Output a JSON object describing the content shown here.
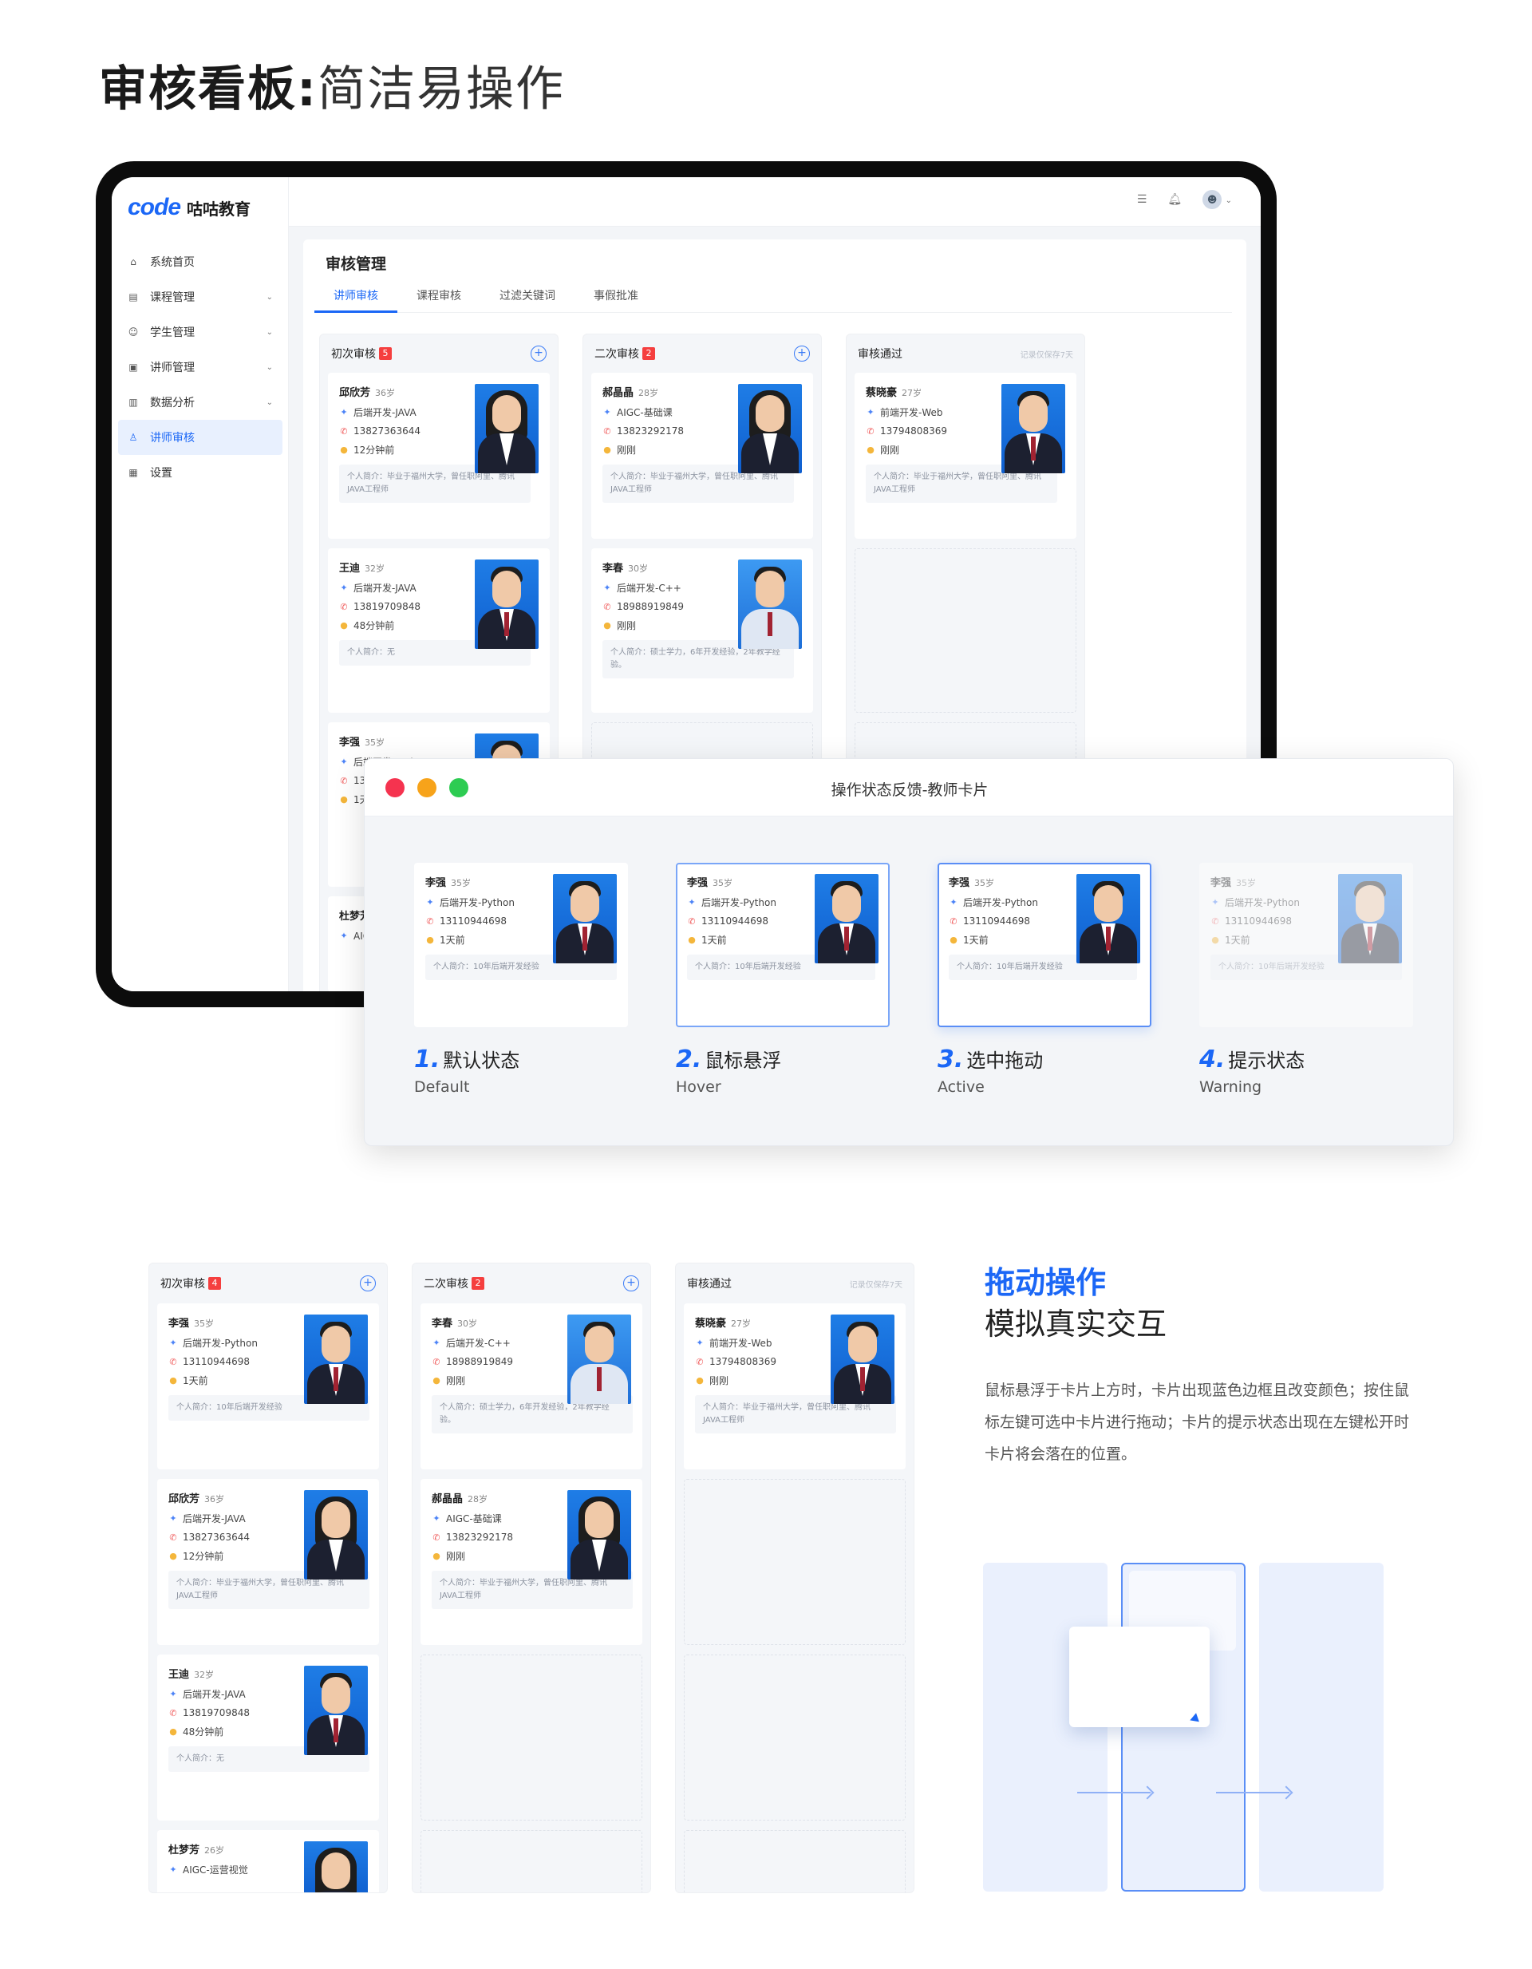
{
  "heading": {
    "bold": "审核看板:",
    "light": "简洁易操作"
  },
  "app": {
    "logo_mark": "code",
    "logo_text": "咕咕教育",
    "menu": [
      {
        "label": "系统首页",
        "icon": "home-icon",
        "chevron": false,
        "active": false
      },
      {
        "label": "课程管理",
        "icon": "book-icon",
        "chevron": true,
        "active": false
      },
      {
        "label": "学生管理",
        "icon": "users-icon",
        "chevron": true,
        "active": false
      },
      {
        "label": "讲师管理",
        "icon": "id-card-icon",
        "chevron": true,
        "active": false
      },
      {
        "label": "数据分析",
        "icon": "chart-icon",
        "chevron": true,
        "active": false
      },
      {
        "label": "讲师审核",
        "icon": "user-check-icon",
        "chevron": false,
        "active": true
      },
      {
        "label": "设置",
        "icon": "grid-icon",
        "chevron": false,
        "active": false
      }
    ],
    "content_title": "审核管理",
    "tabs": [
      "讲师审核",
      "课程审核",
      "过滤关键词",
      "事假批准"
    ]
  },
  "columns": {
    "first": {
      "title": "初次审核",
      "count": "5"
    },
    "second": {
      "title": "二次审核",
      "count": "2"
    },
    "passed": {
      "title": "审核通过",
      "note": "记录仅保存7天"
    }
  },
  "cards": {
    "qiu": {
      "name": "邱欣芳",
      "age": "36岁",
      "course": "后端开发-JAVA",
      "phone": "13827363644",
      "time": "12分钟前",
      "bio": "个人简介：毕业于福州大学，曾任职阿里、腾讯JAVA工程师"
    },
    "hao": {
      "name": "郝晶晶",
      "age": "28岁",
      "course": "AIGC-基础课",
      "phone": "13823292178",
      "time": "刚刚",
      "bio": "个人简介：毕业于福州大学，曾任职阿里、腾讯JAVA工程师"
    },
    "cai": {
      "name": "蔡晓豪",
      "age": "27岁",
      "course": "前端开发-Web",
      "phone": "13794808369",
      "time": "刚刚",
      "bio": "个人简介：毕业于福州大学，曾任职阿里、腾讯JAVA工程师"
    },
    "wang": {
      "name": "王迪",
      "age": "32岁",
      "course": "后端开发-JAVA",
      "phone": "13819709848",
      "time": "48分钟前",
      "bio": "个人简介：无"
    },
    "lichun": {
      "name": "李春",
      "age": "30岁",
      "course": "后端开发-C++",
      "phone": "18988919849",
      "time": "刚刚",
      "bio": "个人简介：硕士学力，6年开发经验，2年教学经验。"
    },
    "liqiang": {
      "name": "李强",
      "age": "35岁",
      "course": "后端开发-Python",
      "phone": "13110944698",
      "time": "1天前",
      "bio": "个人简介：10年后端开发经验"
    },
    "du": {
      "name": "杜梦芳",
      "age": "26岁",
      "course": "AIGC-运营视觉"
    }
  },
  "popup": {
    "title": "操作状态反馈-教师卡片",
    "traffic_colors": [
      "#f5334f",
      "#f7a31a",
      "#2dcc52"
    ],
    "states": [
      {
        "num": "1.",
        "label": "默认状态",
        "sub": "Default"
      },
      {
        "num": "2.",
        "label": "鼠标悬浮",
        "sub": "Hover"
      },
      {
        "num": "3.",
        "label": "选中拖动",
        "sub": "Active"
      },
      {
        "num": "4.",
        "label": "提示状态",
        "sub": "Warning"
      }
    ]
  },
  "bottom_columns": {
    "first": {
      "title": "初次审核",
      "count": "4"
    },
    "second": {
      "title": "二次审核",
      "count": "2"
    },
    "passed": {
      "title": "审核通过",
      "note": "记录仅保存7天"
    }
  },
  "drag": {
    "title": "拖动操作",
    "subtitle": "模拟真实交互",
    "desc": "鼠标悬浮于卡片上方时，卡片出现蓝色边框且改变颜色；按住鼠标左键可选中卡片进行拖动；卡片的提示状态出现在左键松开时卡片将会落在的位置。"
  },
  "colors": {
    "accent": "#1b67f6",
    "badge": "#f53f3f"
  }
}
